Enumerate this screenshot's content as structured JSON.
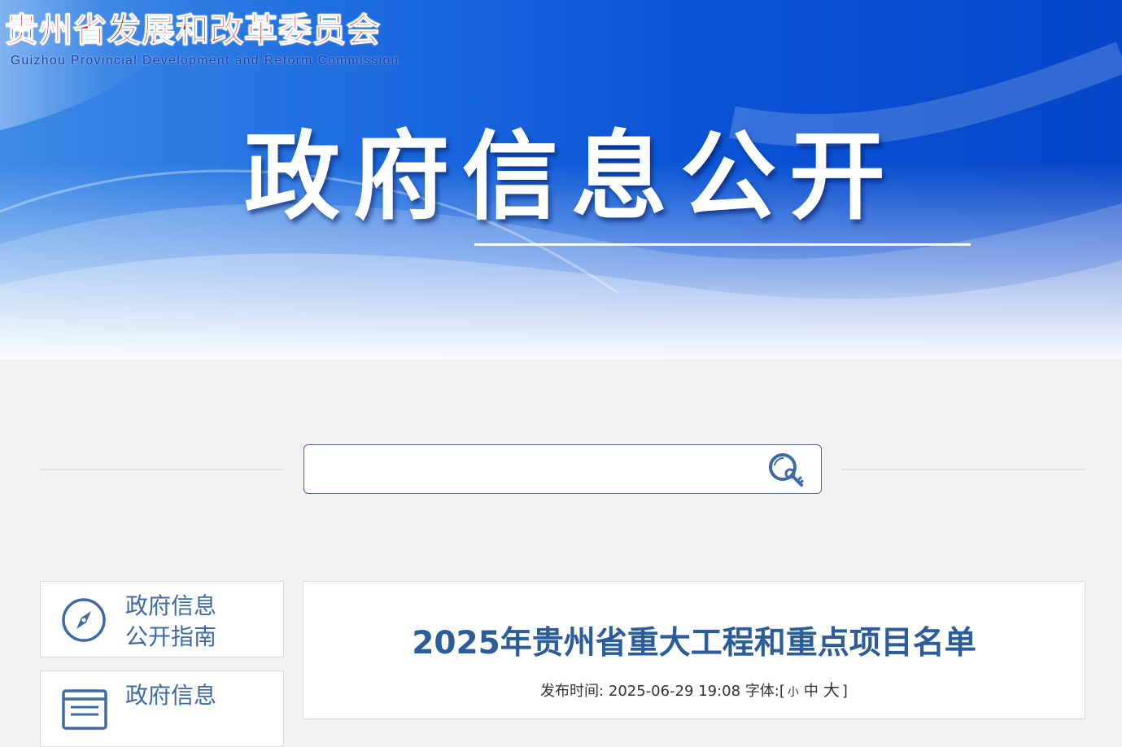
{
  "header": {
    "org_name_cn": "贵州省发展和改革委员会",
    "org_name_en": "Guizhou Provincial Development and Reform Commission",
    "banner_title": "政府信息公开"
  },
  "search": {
    "placeholder": "",
    "value": "",
    "button_icon": "search-key-icon"
  },
  "sidebar": {
    "items": [
      {
        "label_line1": "政府信息",
        "label_line2": "公开指南",
        "icon": "compass-icon"
      },
      {
        "label_line1": "政府信息",
        "label_line2": "",
        "icon": "document-list-icon"
      }
    ]
  },
  "article": {
    "title": "2025年贵州省重大工程和重点项目名单",
    "publish_label": "发布时间:",
    "publish_time": "2025-06-29 19:08",
    "font_label": "字体:[",
    "font_small": "小",
    "font_medium": "中",
    "font_large": "大",
    "font_close": "]"
  },
  "colors": {
    "banner_blue": "#0a55d6",
    "org_red": "#c9140f",
    "accent_blue": "#3d6aa4",
    "title_blue": "#2b5d9a",
    "page_bg": "#f2f2f2"
  }
}
